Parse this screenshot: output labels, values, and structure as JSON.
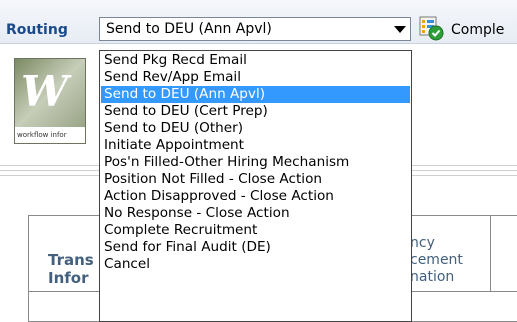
{
  "toolbar": {
    "routing_label": "Routing",
    "selected_value": "Send to DEU (Ann Apvl)",
    "complete_label": "Comple"
  },
  "dropdown": {
    "options": [
      "Send Pkg Recd Email",
      "Send Rev/App Email",
      "Send to DEU (Ann Apvl)",
      "Send to DEU (Cert Prep)",
      "Send to DEU (Other)",
      "Initiate Appointment",
      "Pos'n Filled-Other Hiring Mechanism",
      "Position Not Filled - Close Action",
      "Action Disapproved - Close Action",
      "No Response - Close Action",
      "Complete Recruitment",
      "Send for Final Audit (DE)",
      "Cancel"
    ],
    "selected_index": 2
  },
  "logo": {
    "letters": "W",
    "caption": "workflow infor"
  },
  "table": {
    "col1_line1": "Trans",
    "col1_line2": "Infor",
    "col2_line1": "ncy",
    "col2_line2": "cement",
    "col2_line3": "nation"
  },
  "colors": {
    "selection": "#3399ff",
    "header_text": "#43607f",
    "routing_label": "#1a4a8c"
  }
}
